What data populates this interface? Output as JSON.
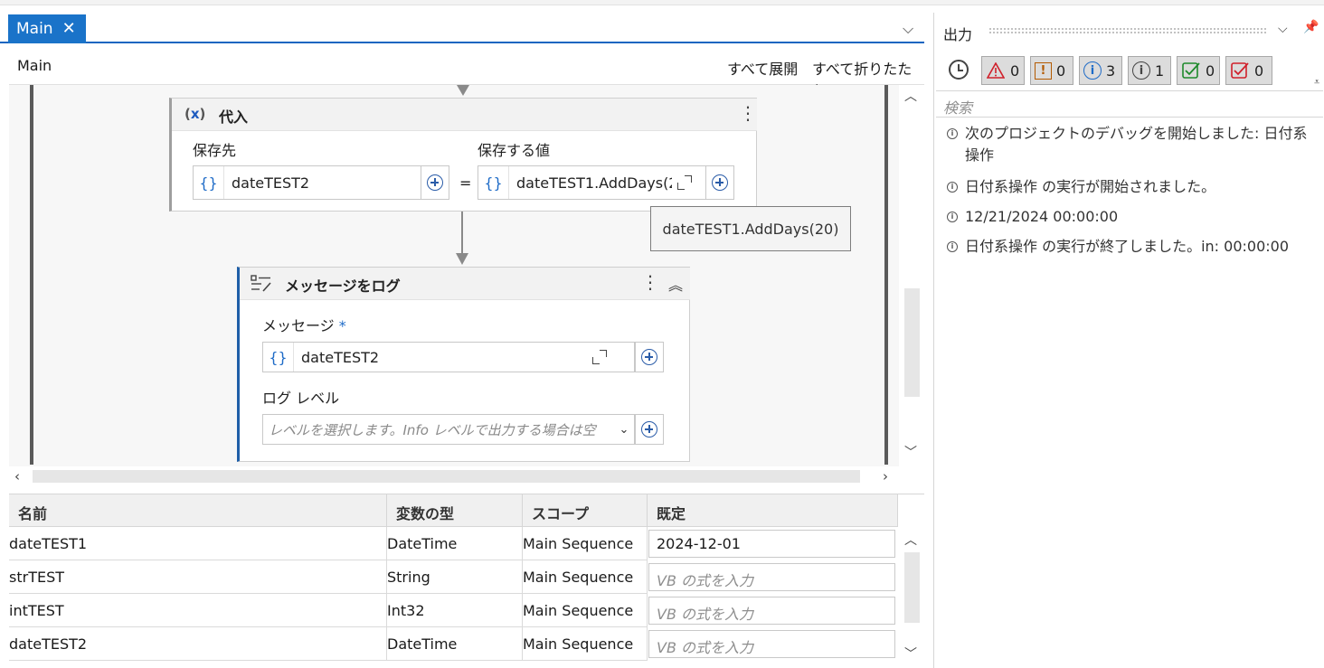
{
  "designer": {
    "tab_label": "Main",
    "tab_close": "✕",
    "breadcrumb": "Main",
    "expand_all": "すべて展開",
    "collapse_all": "すべて折りたたむ"
  },
  "assign": {
    "icon": "(x)",
    "title": "代入",
    "to_label": "保存先",
    "to_value": "dateTEST2",
    "value_label": "保存する値",
    "value_value": "dateTEST1.AddDays(2",
    "equals": "=",
    "tooltip": "dateTEST1.AddDays(20)"
  },
  "log_message": {
    "title": "メッセージをログ",
    "message_label": "メッセージ",
    "required_mark": "*",
    "message_value": "dateTEST2",
    "level_label": "ログ レベル",
    "level_placeholder": "レベルを選択します。Info レベルで出力する場合は空"
  },
  "variables": {
    "headers": [
      "名前",
      "変数の型",
      "スコープ",
      "既定"
    ],
    "rows": [
      {
        "name": "dateTEST1",
        "type": "DateTime",
        "scope": "Main Sequence",
        "default": "2024-12-01"
      },
      {
        "name": "strTEST",
        "type": "String",
        "scope": "Main Sequence",
        "default": "VB の式を入力"
      },
      {
        "name": "intTEST",
        "type": "Int32",
        "scope": "Main Sequence",
        "default": "VB の式を入力"
      },
      {
        "name": "dateTEST2",
        "type": "DateTime",
        "scope": "Main Sequence",
        "default": "VB の式を入力"
      }
    ]
  },
  "output": {
    "title": "出力",
    "filters": [
      {
        "icon": "warning-icon",
        "count": "0",
        "color": "#d0202b"
      },
      {
        "icon": "error-icon",
        "count": "0",
        "color": "#b35a00"
      },
      {
        "icon": "info-icon",
        "count": "3",
        "color": "#1e6bc7"
      },
      {
        "icon": "trace-icon",
        "count": "1",
        "color": "#444444"
      },
      {
        "icon": "success-icon",
        "count": "0",
        "color": "#1f8a2c"
      },
      {
        "icon": "failure-icon",
        "count": "0",
        "color": "#d0202b"
      }
    ],
    "search_placeholder": "検索",
    "entries": [
      "次のプロジェクトのデバッグを開始しました: 日付系操作",
      "日付系操作 の実行が開始されました。",
      "12/21/2024 00:00:00",
      "日付系操作 の実行が終了しました。in: 00:00:00"
    ]
  }
}
